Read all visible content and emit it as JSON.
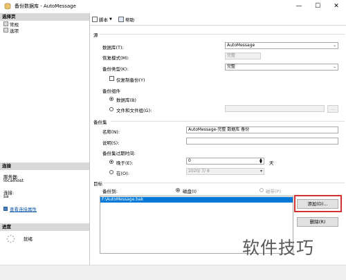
{
  "window": {
    "title": "备份数据库 - AutoMessage",
    "minimize": "—",
    "maximize": "☐",
    "close": "✕"
  },
  "left": {
    "select_page_header": "选择页",
    "nav": [
      "常规",
      "选项"
    ],
    "connection_header": "连接",
    "server_label": "服务器:",
    "server_value": "localhost",
    "connection_label": "连接:",
    "connection_value": "sa",
    "view_conn_props": "查看连接属性",
    "progress_header": "进度",
    "progress_status": "就绪"
  },
  "toolbar": {
    "script": "脚本",
    "help": "帮助"
  },
  "source": {
    "group": "源",
    "database_label": "数据库(T):",
    "database_value": "AutoMessage",
    "recovery_label": "恢复模式(M):",
    "recovery_value": "完整",
    "backup_type_label": "备份类型(K):",
    "backup_type_value": "完整",
    "copy_only_label": "仅复制备份(Y)",
    "component_label": "备份组件",
    "component_db": "数据库(B)",
    "component_files": "文件和文件组(G):",
    "browse": "..."
  },
  "backup_set": {
    "group": "备份集",
    "name_label": "名称(N):",
    "name_value": "AutoMessage-完整 数据库 备份",
    "desc_label": "说明(S):",
    "desc_value": "",
    "expire_label": "备份集过期时间:",
    "after_label": "晚于(E):",
    "after_value": "0",
    "days_label": "天",
    "on_label": "在(O):",
    "on_value": "2020/ 7/ 8"
  },
  "destination": {
    "group": "目标",
    "backup_to_label": "备份到:",
    "disk_label": "磁盘(I)",
    "tape_label": "磁带(P)",
    "list": [
      "F:\\AutoMessage.bak"
    ],
    "add_button": "添加(D)...",
    "remove_button": "删除(R)"
  },
  "watermark": "软件技巧"
}
